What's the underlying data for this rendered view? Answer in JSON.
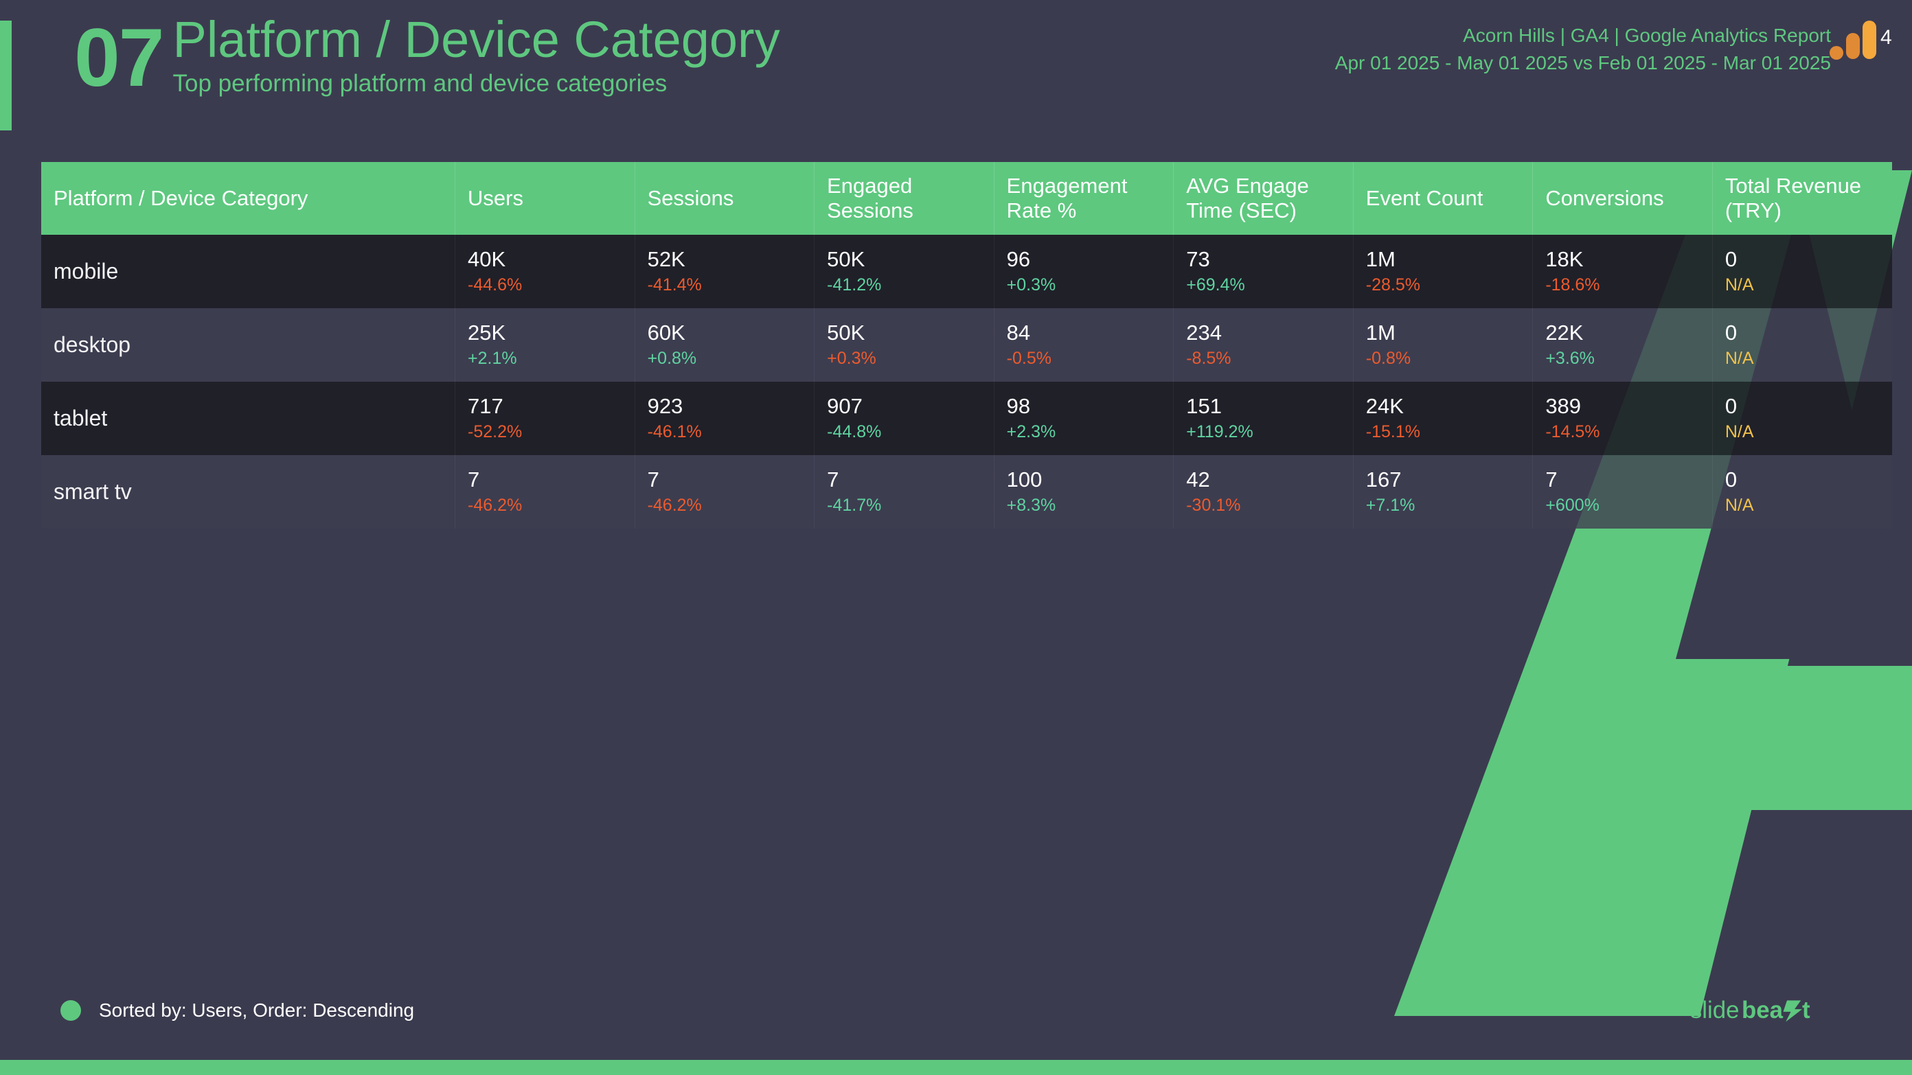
{
  "slide": {
    "number": "07",
    "title": "Platform / Device Category",
    "subtitle": "Top performing platform and device categories",
    "accent_color": "#5ec87f",
    "background_color": "#3b3b4f"
  },
  "report_meta": {
    "source_line": "Acorn Hills | GA4 | Google Analytics Report",
    "date_range_line": "Apr 01 2025 - May 01 2025 vs Feb 01 2025 - Mar 01 2025",
    "logo_label": "4"
  },
  "table": {
    "columns": [
      "Platform / Device Category",
      "Users",
      "Sessions",
      "Engaged Sessions",
      "Engagement Rate %",
      "AVG Engage Time (SEC)",
      "Event Count",
      "Conversions",
      "Total Revenue (TRY)"
    ],
    "rows": [
      {
        "category": "mobile",
        "cells": [
          {
            "value": "40K",
            "delta": "-44.6%",
            "trend": "down"
          },
          {
            "value": "52K",
            "delta": "-41.4%",
            "trend": "down"
          },
          {
            "value": "50K",
            "delta": "-41.2%",
            "trend": "up"
          },
          {
            "value": "96",
            "delta": "+0.3%",
            "trend": "up"
          },
          {
            "value": "73",
            "delta": "+69.4%",
            "trend": "up"
          },
          {
            "value": "1M",
            "delta": "-28.5%",
            "trend": "down"
          },
          {
            "value": "18K",
            "delta": "-18.6%",
            "trend": "down"
          },
          {
            "value": "0",
            "delta": "N/A",
            "trend": "na"
          }
        ]
      },
      {
        "category": "desktop",
        "cells": [
          {
            "value": "25K",
            "delta": "+2.1%",
            "trend": "up"
          },
          {
            "value": "60K",
            "delta": "+0.8%",
            "trend": "up"
          },
          {
            "value": "50K",
            "delta": "+0.3%",
            "trend": "down"
          },
          {
            "value": "84",
            "delta": "-0.5%",
            "trend": "down"
          },
          {
            "value": "234",
            "delta": "-8.5%",
            "trend": "down"
          },
          {
            "value": "1M",
            "delta": "-0.8%",
            "trend": "down"
          },
          {
            "value": "22K",
            "delta": "+3.6%",
            "trend": "up"
          },
          {
            "value": "0",
            "delta": "N/A",
            "trend": "na"
          }
        ]
      },
      {
        "category": "tablet",
        "cells": [
          {
            "value": "717",
            "delta": "-52.2%",
            "trend": "down"
          },
          {
            "value": "923",
            "delta": "-46.1%",
            "trend": "down"
          },
          {
            "value": "907",
            "delta": "-44.8%",
            "trend": "up"
          },
          {
            "value": "98",
            "delta": "+2.3%",
            "trend": "up"
          },
          {
            "value": "151",
            "delta": "+119.2%",
            "trend": "up"
          },
          {
            "value": "24K",
            "delta": "-15.1%",
            "trend": "down"
          },
          {
            "value": "389",
            "delta": "-14.5%",
            "trend": "down"
          },
          {
            "value": "0",
            "delta": "N/A",
            "trend": "na"
          }
        ]
      },
      {
        "category": "smart tv",
        "cells": [
          {
            "value": "7",
            "delta": "-46.2%",
            "trend": "down"
          },
          {
            "value": "7",
            "delta": "-46.2%",
            "trend": "down"
          },
          {
            "value": "7",
            "delta": "-41.7%",
            "trend": "up"
          },
          {
            "value": "100",
            "delta": "+8.3%",
            "trend": "up"
          },
          {
            "value": "42",
            "delta": "-30.1%",
            "trend": "down"
          },
          {
            "value": "167",
            "delta": "+7.1%",
            "trend": "up"
          },
          {
            "value": "7",
            "delta": "+600%",
            "trend": "up"
          },
          {
            "value": "0",
            "delta": "N/A",
            "trend": "na"
          }
        ]
      }
    ]
  },
  "footer": {
    "sort_note": "Sorted by: Users, Order: Descending",
    "brand_name": "slidebeast"
  },
  "colors": {
    "accent_green": "#5ec87f",
    "delta_up": "#5fd3a0",
    "delta_down": "#ec5b2d",
    "delta_na": "#f0c14b",
    "header_bg": "#5ec87f",
    "row_odd": "#1e1e26",
    "row_even": "#3e3e50",
    "ga_orange_dark": "#e08a35",
    "ga_orange_light": "#f5a93c"
  }
}
